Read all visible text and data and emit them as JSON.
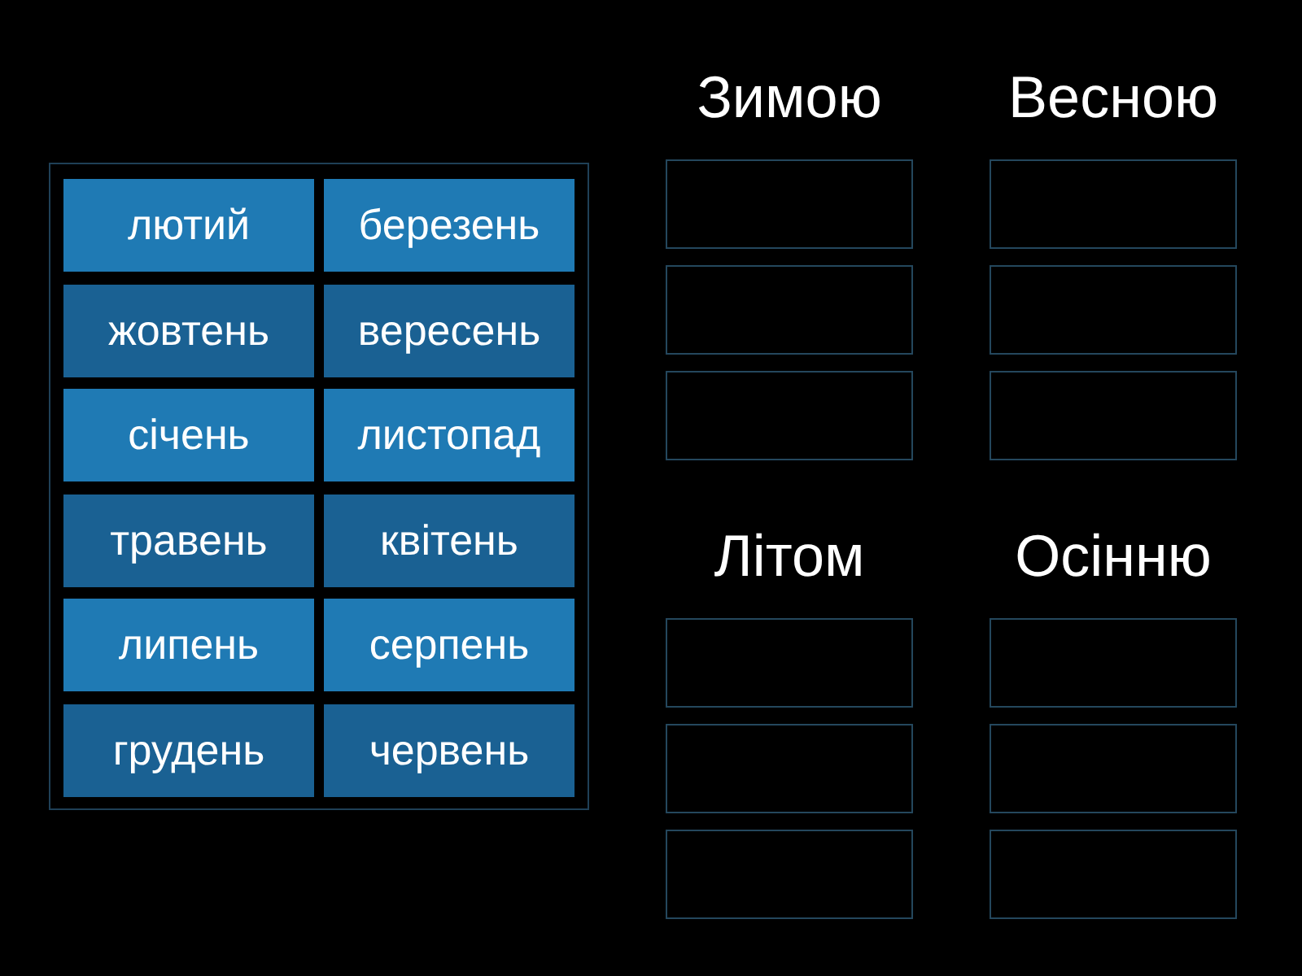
{
  "tiles": [
    {
      "label": "лютий",
      "color": "#1f7ab4"
    },
    {
      "label": "березень",
      "color": "#1f7ab4"
    },
    {
      "label": "жовтень",
      "color": "#1a6193"
    },
    {
      "label": "вересень",
      "color": "#1a6193"
    },
    {
      "label": "січень",
      "color": "#1f7ab4"
    },
    {
      "label": "листопад",
      "color": "#1f7ab4"
    },
    {
      "label": "травень",
      "color": "#1a6193"
    },
    {
      "label": "квітень",
      "color": "#1a6193"
    },
    {
      "label": "липень",
      "color": "#1f7ab4"
    },
    {
      "label": "серпень",
      "color": "#1f7ab4"
    },
    {
      "label": "грудень",
      "color": "#1a6193"
    },
    {
      "label": "червень",
      "color": "#1a6193"
    }
  ],
  "groups": [
    {
      "title": "Зимою"
    },
    {
      "title": "Весною"
    },
    {
      "title": "Літом"
    },
    {
      "title": "Осінню"
    }
  ]
}
